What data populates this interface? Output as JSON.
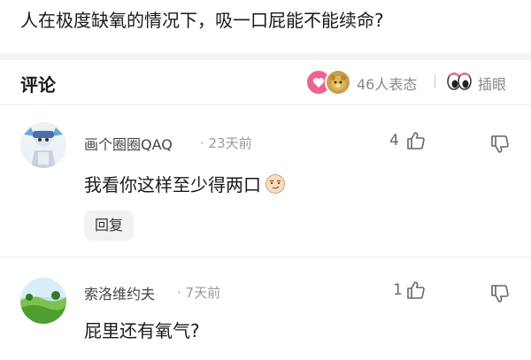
{
  "question": {
    "title": "人在极度缺氧的情况下，吸一口屁能不能续命?"
  },
  "comments_header": {
    "title": "评论",
    "reaction_count": "46人表态",
    "peek_label": "插眼",
    "reaction_icons": [
      "love-reaction-icon",
      "bear-reaction-icon"
    ],
    "colors": {
      "love": "#f06292",
      "bear": "#c8a14a"
    }
  },
  "comments": [
    {
      "username": "画个圈圈QAQ",
      "time": "· 23天前",
      "likes": "4",
      "text": "我看你这样至少得两口",
      "emoji": "smirk-face-icon",
      "reply_label": "回复",
      "avatar": "anime-avatar"
    },
    {
      "username": "索洛维约夫",
      "time": "· 7天前",
      "likes": "1",
      "text": "屁里还有氧气?",
      "avatar": "landscape-avatar"
    }
  ]
}
